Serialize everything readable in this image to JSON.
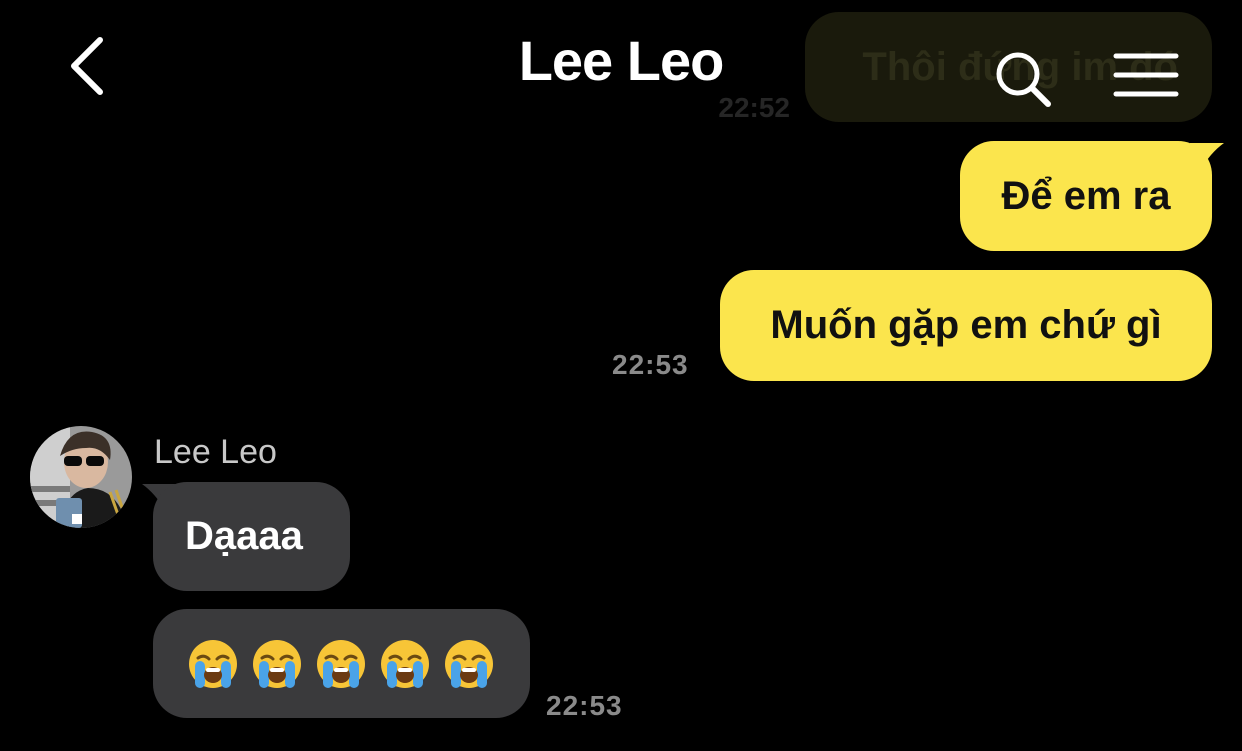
{
  "header": {
    "title": "Lee Leo",
    "back_icon": "chevron-left-icon",
    "search_icon": "search-icon",
    "menu_icon": "hamburger-menu-icon"
  },
  "colors": {
    "background": "#000000",
    "outgoing_bubble": "#fbe54d",
    "incoming_bubble": "#3a3a3c",
    "timestamp": "#8a8a8a"
  },
  "previous_message": {
    "text": "Thôi đứng im đó",
    "time": "22:52"
  },
  "outgoing_messages": [
    {
      "text": "Để em ra"
    },
    {
      "text": "Muốn gặp em chứ gì"
    }
  ],
  "outgoing_time": "22:53",
  "incoming": {
    "sender": "Lee Leo",
    "avatar_icon": "avatar-photo",
    "messages": [
      {
        "text": "Dạaaa"
      },
      {
        "emoji_icon": "loudly-crying-face-emoji",
        "count": 5
      }
    ],
    "time": "22:53"
  }
}
